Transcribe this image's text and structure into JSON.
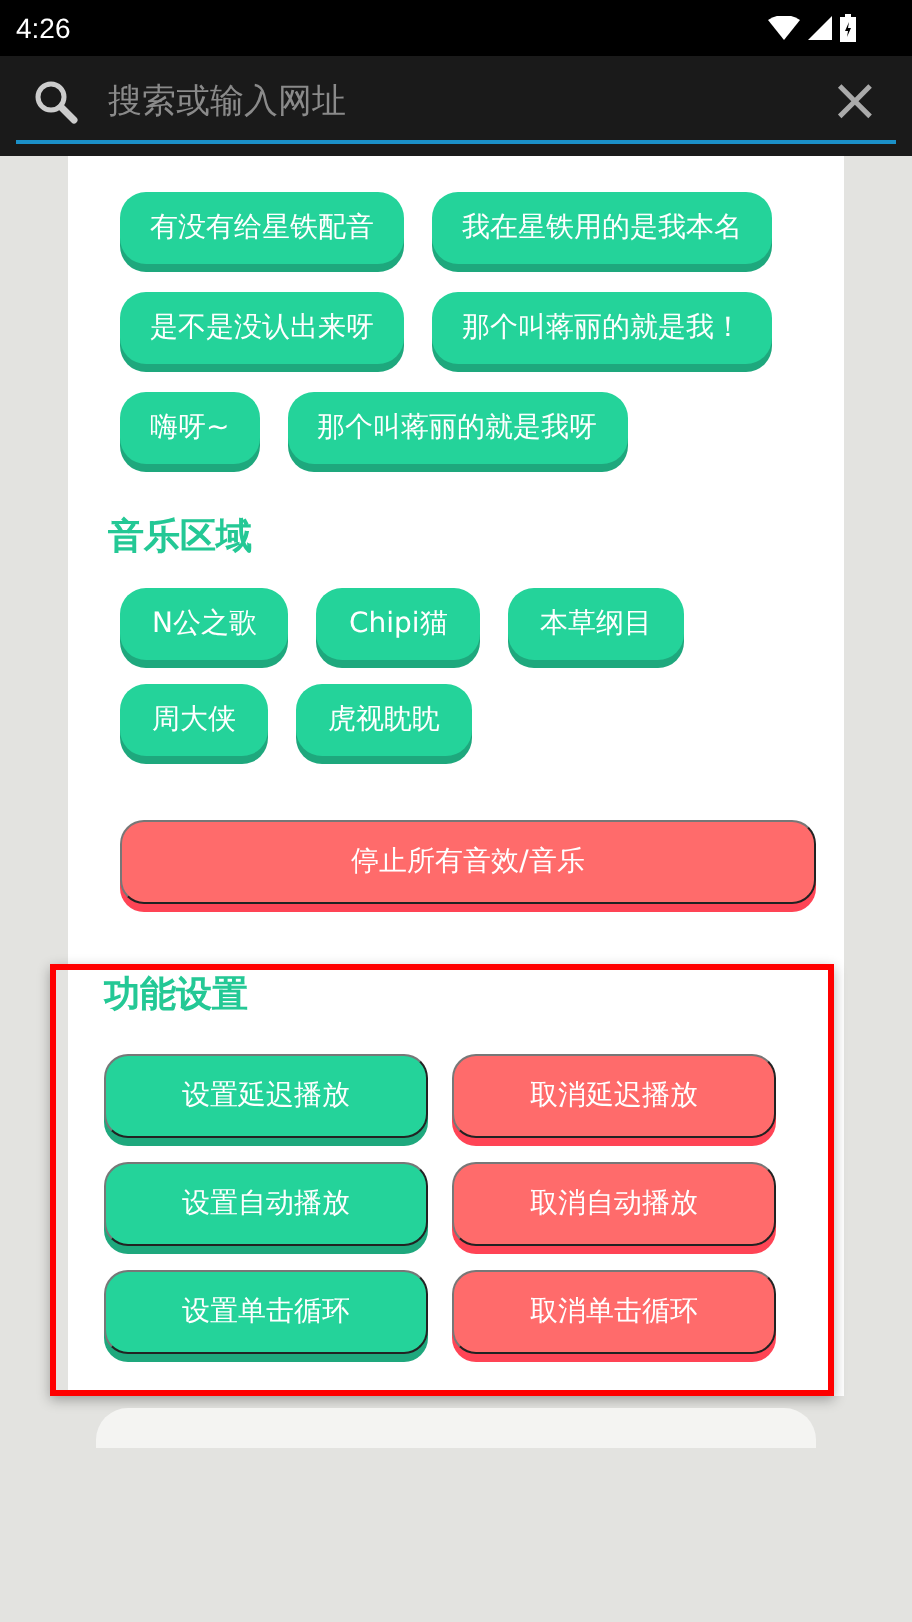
{
  "status_bar": {
    "time": "4:26"
  },
  "search": {
    "placeholder": "搜索或输入网址",
    "close": "×"
  },
  "voice_buttons": [
    "有没有给星铁配音",
    "我在星铁用的是我本名",
    "是不是没认出来呀",
    "那个叫蒋丽的就是我！",
    "嗨呀~",
    "那个叫蒋丽的就是我呀"
  ],
  "music": {
    "title": "音乐区域",
    "buttons": [
      "N公之歌",
      "Chipi猫",
      "本草纲目",
      "周大侠",
      "虎视眈眈"
    ],
    "stop_button": "停止所有音效/音乐"
  },
  "settings": {
    "title": "功能设置",
    "buttons": [
      {
        "label": "设置延迟播放",
        "kind": "set"
      },
      {
        "label": "取消延迟播放",
        "kind": "cancel"
      },
      {
        "label": "设置自动播放",
        "kind": "set"
      },
      {
        "label": "取消自动播放",
        "kind": "cancel"
      },
      {
        "label": "设置单击循环",
        "kind": "set"
      },
      {
        "label": "取消单击循环",
        "kind": "cancel"
      }
    ]
  }
}
